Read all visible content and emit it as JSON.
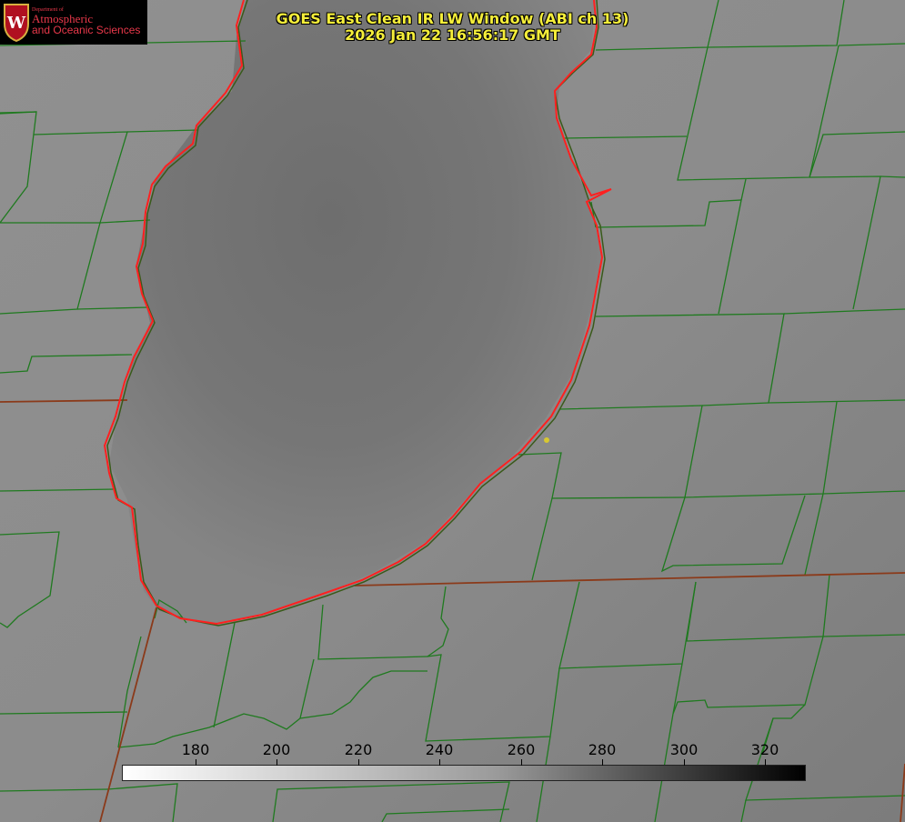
{
  "title": {
    "line1": "GOES East Clean IR LW Window (ABI ch 13)",
    "line2": "2026 Jan 22 16:56:17 GMT"
  },
  "logo": {
    "dept": "Department of",
    "line1": "Atmospheric",
    "line2": "and Oceanic Sciences",
    "crest_letter": "W"
  },
  "colorbar": {
    "ticks": [
      "180",
      "200",
      "220",
      "240",
      "260",
      "280",
      "300",
      "320"
    ]
  },
  "colors": {
    "title_text": "#f5ee3a",
    "county_lines": "#1f7a1f",
    "state_lines": "#8b3a1a",
    "lake_outline": "#ff2020",
    "logo_text": "#e8384a"
  }
}
